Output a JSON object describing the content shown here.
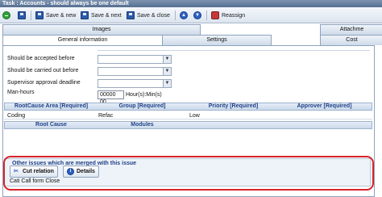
{
  "window": {
    "title": "Task : Accounts - should always be one default"
  },
  "toolbar": {
    "save_new": "Save & new",
    "save_next": "Save & next",
    "save_close": "Save & close",
    "reassign": "Reassign"
  },
  "tabs": {
    "row1": [
      "Images",
      "Attachme"
    ],
    "row2": [
      "General information",
      "Settings",
      "Cost"
    ]
  },
  "form": {
    "accepted_before": "Should be accepted before",
    "carried_out_before": "Should be carried out before",
    "supervisor_deadline": "Supervisor approval deadline",
    "man_hours_label": "Man-hours",
    "man_hours_value": "00000 00",
    "man_hours_unit": "Hour(s):Min(s)"
  },
  "grid1": {
    "headers": [
      "RootCause Area [Required]",
      "Group [Required]",
      "Priority [Required]",
      "Approver [Required]"
    ],
    "row": [
      "Coding",
      "Refac",
      "Low",
      ""
    ]
  },
  "grid2": {
    "headers": [
      "Root Cause",
      "Modules"
    ]
  },
  "merged": {
    "title": "Other issues which are merged with this issue",
    "cut_relation": "Cut relation",
    "details": "Details",
    "item": "Cati Call form Close"
  }
}
